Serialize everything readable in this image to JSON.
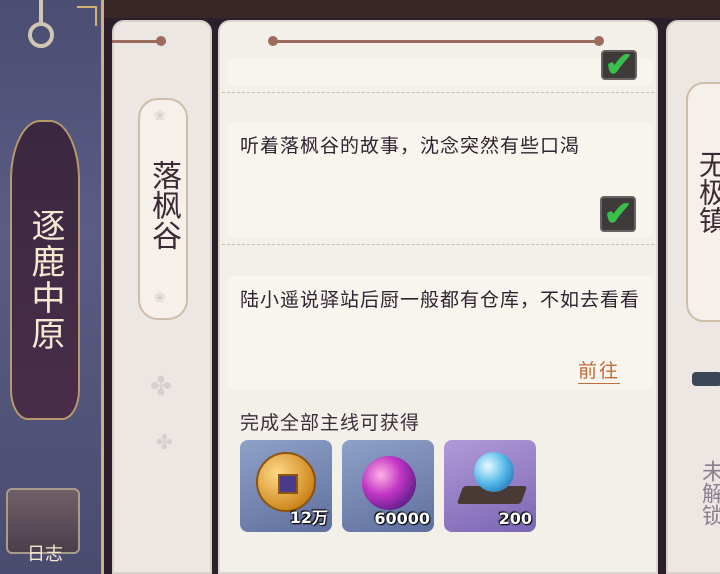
{
  "sidebar": {
    "chapter_title": "逐鹿中原",
    "log_label": "日志"
  },
  "chapter_tab": {
    "title": "落枫谷"
  },
  "quests": [
    {
      "text": "",
      "completed": true
    },
    {
      "text": "听着落枫谷的故事，沈念突然有些口渴",
      "completed": true
    },
    {
      "text": "陆小遥说驿站后厨一般都有仓库，不如去看看",
      "completed": false,
      "action_label": "前往"
    }
  ],
  "rewards": {
    "heading": "完成全部主线可获得",
    "items": [
      {
        "icon": "copper-coin-icon",
        "qty": "12万"
      },
      {
        "icon": "purple-orb-icon",
        "qty": "60000"
      },
      {
        "icon": "blue-orb-icon",
        "qty": "200"
      }
    ]
  },
  "next_chapter": {
    "title": "无极镇",
    "locked_label": "未解锁"
  },
  "colors": {
    "check_green": "#38c04a",
    "goto_orange": "#c06b3a",
    "sidebar_purple": "#4b4d72"
  }
}
